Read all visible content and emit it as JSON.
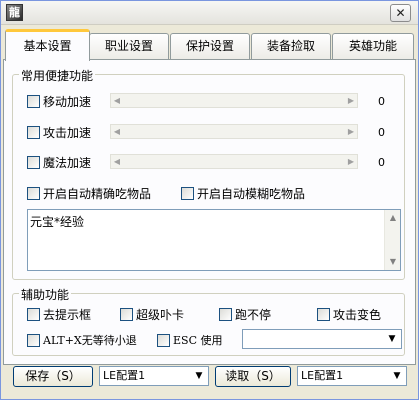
{
  "titlebar": {
    "app_icon_glyph": "龍",
    "close_glyph": "✕"
  },
  "tabs": [
    {
      "label": "基本设置",
      "active": true
    },
    {
      "label": "职业设置",
      "active": false
    },
    {
      "label": "保护设置",
      "active": false
    },
    {
      "label": "装备捡取",
      "active": false
    },
    {
      "label": "英雄功能",
      "active": false
    }
  ],
  "common": {
    "title": "常用便捷功能",
    "sliders": [
      {
        "label": "移动加速",
        "value": "0"
      },
      {
        "label": "攻击加速",
        "value": "0"
      },
      {
        "label": "魔法加速",
        "value": "0"
      }
    ],
    "auto_eat_exact": "开启自动精确吃物品",
    "auto_eat_fuzzy": "开启自动模糊吃物品",
    "item_list_text": "元宝*经验"
  },
  "aux": {
    "title": "辅助功能",
    "remove_hint": "去提示框",
    "super_unlag": "超级卟卡",
    "no_stop_run": "跑不停",
    "attack_color": "攻击变色",
    "alt_x": "ALT+X无等待小退",
    "esc_use": "ESC 使用",
    "esc_select_value": ""
  },
  "bottom": {
    "save_label": "保存（S）",
    "save_config_value": "LE配置1",
    "read_label": "读取（S）",
    "read_config_value": "LE配置1"
  },
  "icons": {
    "dropdown": "▼",
    "arrow_left": "◀",
    "arrow_right": "▶",
    "arrow_up": "▲",
    "arrow_down": "▼"
  }
}
